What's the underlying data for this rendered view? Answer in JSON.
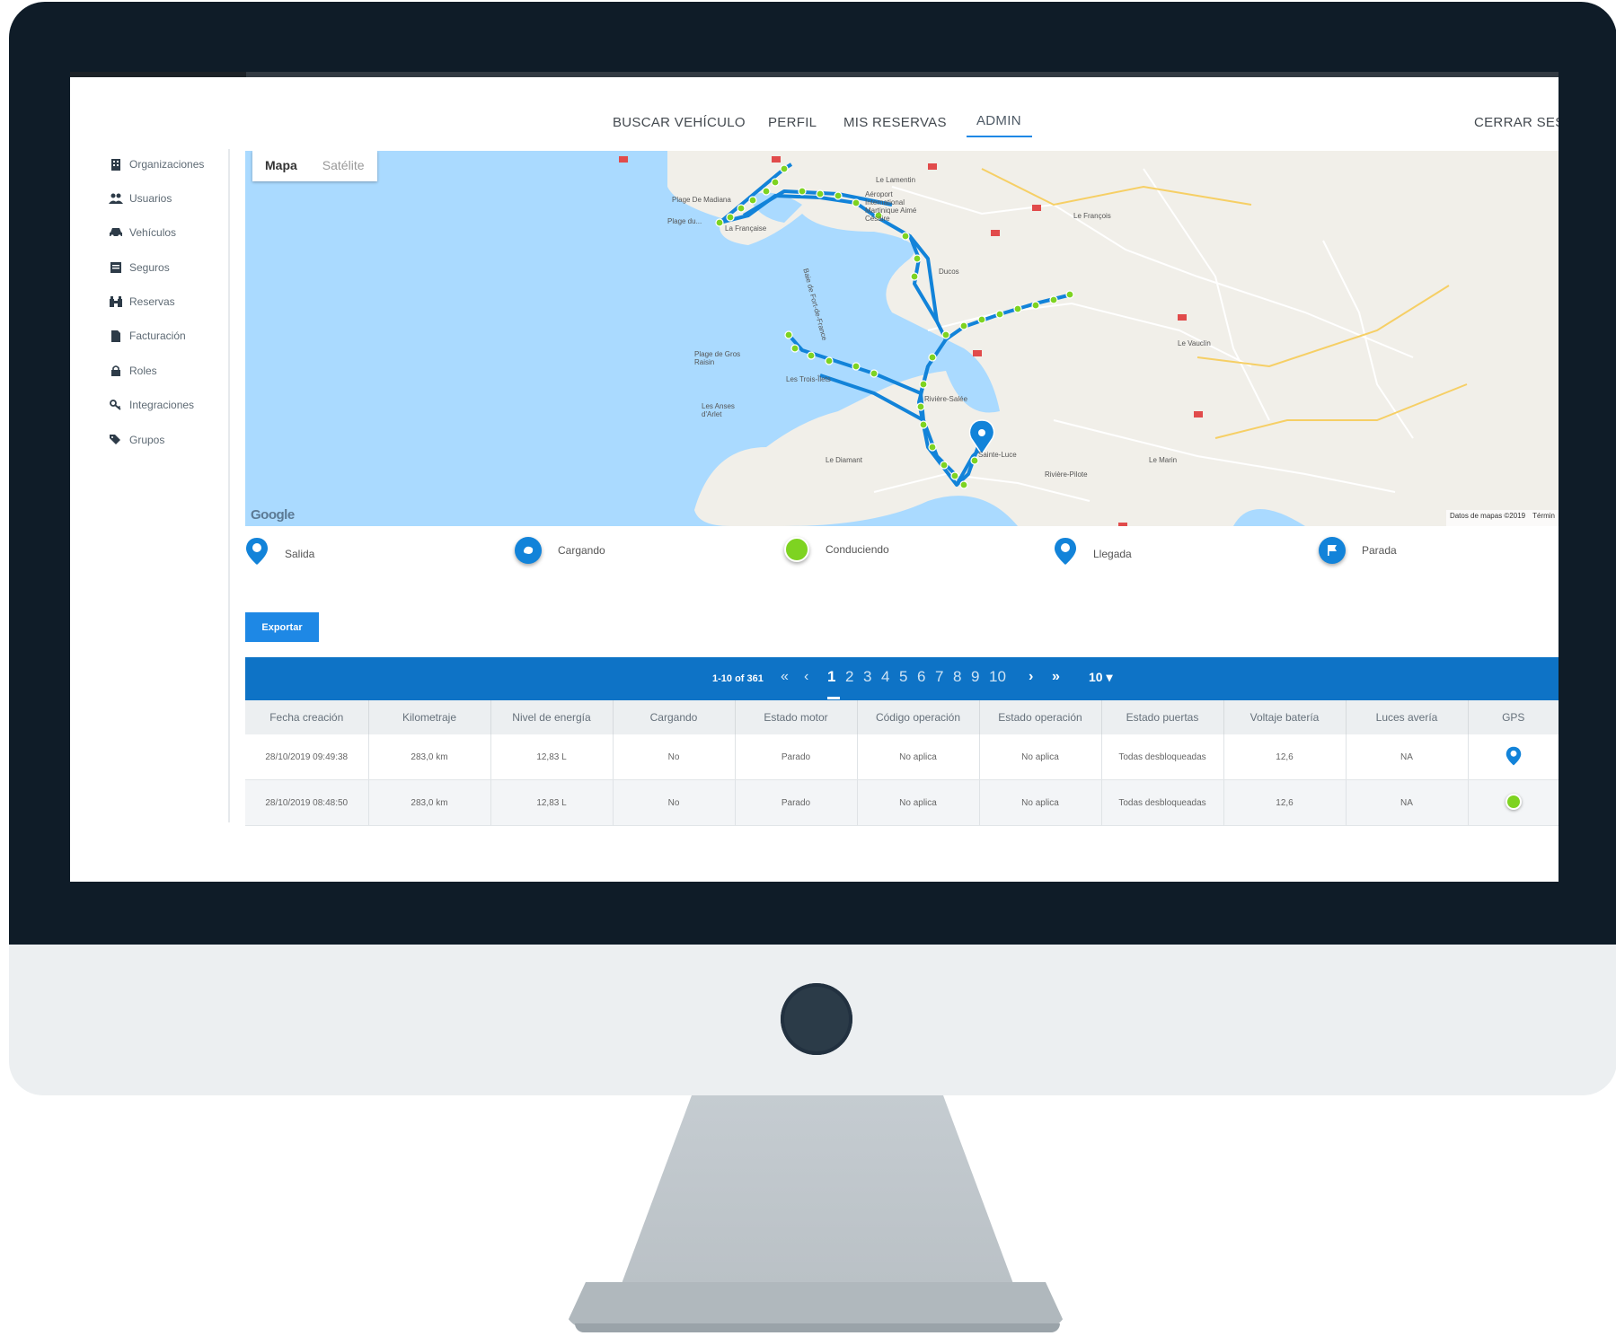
{
  "nav": {
    "items": [
      "BUSCAR VEHÍCULO",
      "PERFIL",
      "MIS RESERVAS",
      "ADMIN"
    ],
    "active": "ADMIN",
    "logout": "CERRAR SESI"
  },
  "sidebar": {
    "items": [
      {
        "label": "Organizaciones",
        "icon": "building-icon"
      },
      {
        "label": "Usuarios",
        "icon": "users-icon"
      },
      {
        "label": "Vehículos",
        "icon": "car-icon"
      },
      {
        "label": "Seguros",
        "icon": "list-icon"
      },
      {
        "label": "Reservas",
        "icon": "binoculars-icon"
      },
      {
        "label": "Facturación",
        "icon": "file-icon"
      },
      {
        "label": "Roles",
        "icon": "lock-icon"
      },
      {
        "label": "Integraciones",
        "icon": "key-icon"
      },
      {
        "label": "Grupos",
        "icon": "tags-icon"
      }
    ]
  },
  "map": {
    "tabs": [
      "Mapa",
      "Satélite"
    ],
    "active_tab": "Mapa",
    "logo": "Google",
    "footer": [
      "Datos de mapas ©2019",
      "Términ"
    ],
    "places": [
      "Le Lamentin",
      "Plage De Madiana",
      "Plage du...",
      "La Française",
      "Aéroport International Martinique Aimé Césaire",
      "Le François",
      "Ducos",
      "Plage de Gros Raisin",
      "Les Trois-Îlets",
      "Les Anses d'Arlet",
      "Rivière-Salée",
      "Le Vauclin",
      "Le Diamant",
      "Sainte-Luce",
      "Rivière-Pilote",
      "Le Marin",
      "Baie de Fort-de-France"
    ],
    "colors": {
      "water": "#aadaff",
      "land": "#f1efe9",
      "route": "#1283d9",
      "point": "#7ed321"
    }
  },
  "legend": [
    {
      "label": "Salida",
      "icon": "pin-icon",
      "color": "#1283d9"
    },
    {
      "label": "Cargando",
      "icon": "charging-icon",
      "color": "#1283d9"
    },
    {
      "label": "Conduciendo",
      "icon": "driving-dot-icon",
      "color": "#7ed321"
    },
    {
      "label": "Llegada",
      "icon": "pin-icon",
      "color": "#1283d9"
    },
    {
      "label": "Parada",
      "icon": "flag-icon",
      "color": "#1283d9"
    }
  ],
  "export_label": "Exportar",
  "pager": {
    "info": "1-10 of 361",
    "pages": [
      "1",
      "2",
      "3",
      "4",
      "5",
      "6",
      "7",
      "8",
      "9",
      "10"
    ],
    "current": "1",
    "page_size": "10 ▾",
    "first": "«",
    "prev": "‹",
    "next": "›",
    "last": "»"
  },
  "table": {
    "columns": [
      "Fecha creación",
      "Kilometraje",
      "Nivel de energía",
      "Cargando",
      "Estado motor",
      "Código operación",
      "Estado operación",
      "Estado puertas",
      "Voltaje batería",
      "Luces avería",
      "GPS"
    ],
    "rows": [
      {
        "cells": [
          "28/10/2019 09:49:38",
          "283,0 km",
          "12,83 L",
          "No",
          "Parado",
          "No aplica",
          "No aplica",
          "Todas desbloqueadas",
          "12,6",
          "NA"
        ],
        "gps": "pin-icon"
      },
      {
        "cells": [
          "28/10/2019 08:48:50",
          "283,0 km",
          "12,83 L",
          "No",
          "Parado",
          "No aplica",
          "No aplica",
          "Todas desbloqueadas",
          "12,6",
          "NA"
        ],
        "gps": "driving-dot-icon"
      }
    ]
  }
}
